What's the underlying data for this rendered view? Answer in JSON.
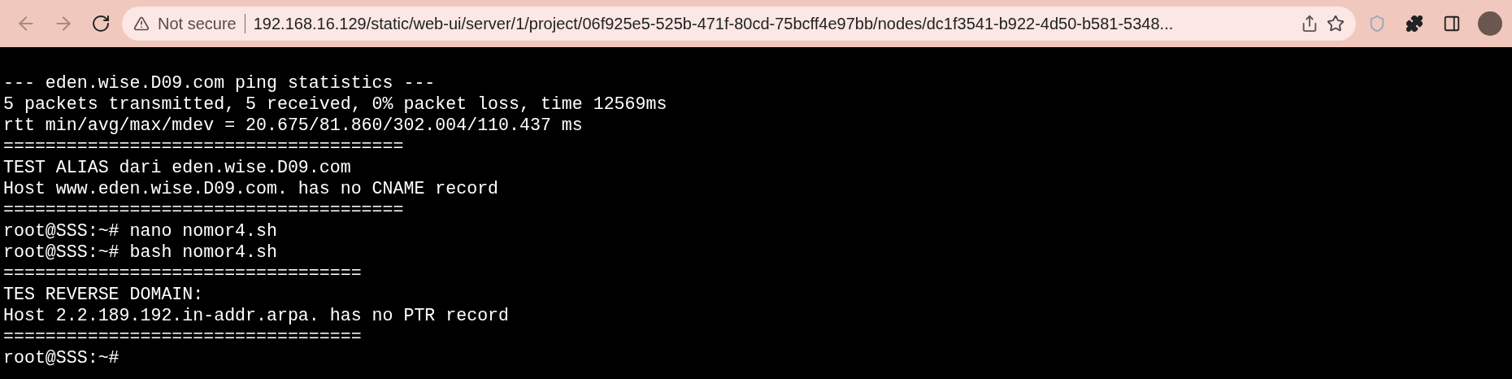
{
  "browser": {
    "security_label": "Not secure",
    "url": "192.168.16.129/static/web-ui/server/1/project/06f925e5-525b-471f-80cd-75bcff4e97bb/nodes/dc1f3541-b922-4d50-b581-5348..."
  },
  "terminal": {
    "lines": [
      "--- eden.wise.D09.com ping statistics ---",
      "5 packets transmitted, 5 received, 0% packet loss, time 12569ms",
      "rtt min/avg/max/mdev = 20.675/81.860/302.004/110.437 ms",
      "======================================",
      "TEST ALIAS dari eden.wise.D09.com",
      "Host www.eden.wise.D09.com. has no CNAME record",
      "======================================",
      "root@SSS:~# nano nomor4.sh",
      "root@SSS:~# bash nomor4.sh",
      "==================================",
      "TES REVERSE DOMAIN:",
      "Host 2.2.189.192.in-addr.arpa. has no PTR record",
      "==================================",
      "root@SSS:~#"
    ]
  }
}
